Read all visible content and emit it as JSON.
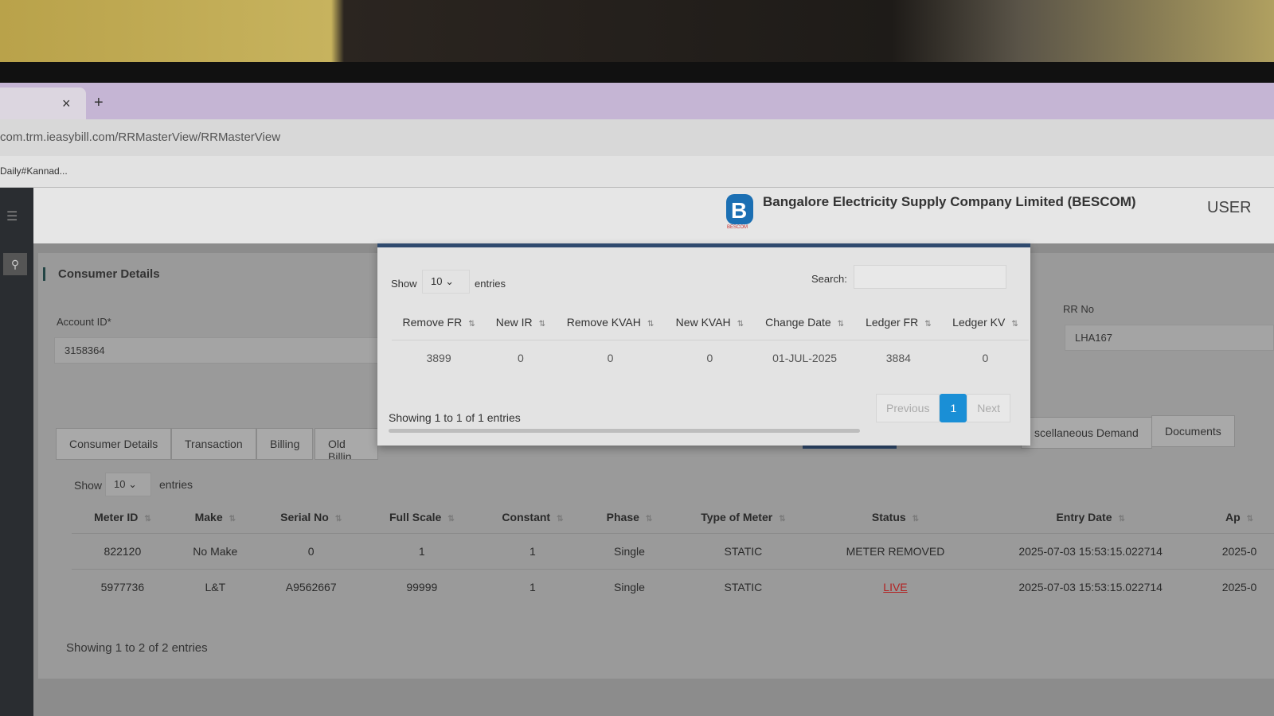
{
  "browser": {
    "url": "com.trm.ieasybill.com/RRMasterView/RRMasterView",
    "bookmark": "Daily#Kannad...",
    "close": "×",
    "new_tab": "+"
  },
  "header": {
    "company": "Bangalore Electricity Supply Company Limited (BESCOM)",
    "user": "USER",
    "logo_text": "BESCOM"
  },
  "consumer": {
    "title": "Consumer Details",
    "account_label": "Account ID*",
    "account_value": "3158364",
    "rr_label": "RR No",
    "rr_value": "LHA167"
  },
  "tabs": [
    "Consumer Details",
    "Transaction",
    "Billing",
    "Old Billin",
    "scellaneous Demand",
    "Documents"
  ],
  "meter_table": {
    "show": "Show",
    "entries_value": "10",
    "entries": "entries",
    "columns": [
      "Meter ID",
      "Make",
      "Serial No",
      "Full Scale",
      "Constant",
      "Phase",
      "Type of Meter",
      "Status",
      "Entry Date",
      "Ap"
    ],
    "rows": [
      [
        "822120",
        "No Make",
        "0",
        "1",
        "1",
        "Single",
        "STATIC",
        "METER REMOVED",
        "2025-07-03 15:53:15.022714",
        "2025-0"
      ],
      [
        "5977736",
        "L&T",
        "A9562667",
        "99999",
        "1",
        "Single",
        "STATIC",
        "LIVE",
        "2025-07-03 15:53:15.022714",
        "2025-0"
      ]
    ],
    "info": "Showing 1 to 2 of 2 entries"
  },
  "modal": {
    "show": "Show",
    "entries_value": "10",
    "entries": "entries",
    "search_label": "Search:",
    "search_value": "",
    "columns": [
      "Remove FR",
      "New IR",
      "Remove KVAH",
      "New KVAH",
      "Change Date",
      "Ledger FR",
      "Ledger KV"
    ],
    "rows": [
      [
        "3899",
        "0",
        "0",
        "0",
        "01-JUL-2025",
        "3884",
        "0"
      ]
    ],
    "info": "Showing 1 to 1 of 1 entries",
    "previous": "Previous",
    "page": "1",
    "next": "Next"
  },
  "colors": {
    "accent": "#1a8fd6",
    "live": "#b22222",
    "modal_border": "#2f4a6e"
  }
}
